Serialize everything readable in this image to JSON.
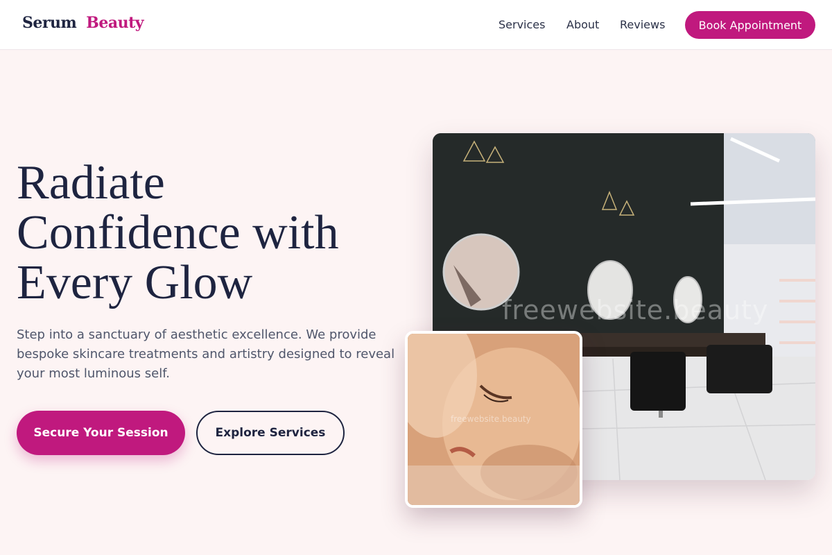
{
  "header": {
    "brand_first": "Serum",
    "brand_second": "Beauty",
    "nav": [
      "Services",
      "About",
      "Reviews"
    ],
    "cta_label": "Book Appointment"
  },
  "hero": {
    "title_lines": [
      "Radiate",
      "Confidence with",
      "Every Glow"
    ],
    "description": "Step into a sanctuary of aesthetic excellence. We provide bespoke skincare treatments and artistry designed to reveal your most luminous self.",
    "primary_cta": "Secure Your Session",
    "secondary_cta": "Explore Services"
  },
  "images": {
    "salon_icon": "salon-interior-photo",
    "model_icon": "model-portrait-photo",
    "salon_watermark": "freewebsite.beauty",
    "model_watermark": "freewebsite.beauty"
  },
  "colors": {
    "accent": "#c0197e",
    "text_dark": "#1e2440",
    "background": "#fdf4f4"
  }
}
